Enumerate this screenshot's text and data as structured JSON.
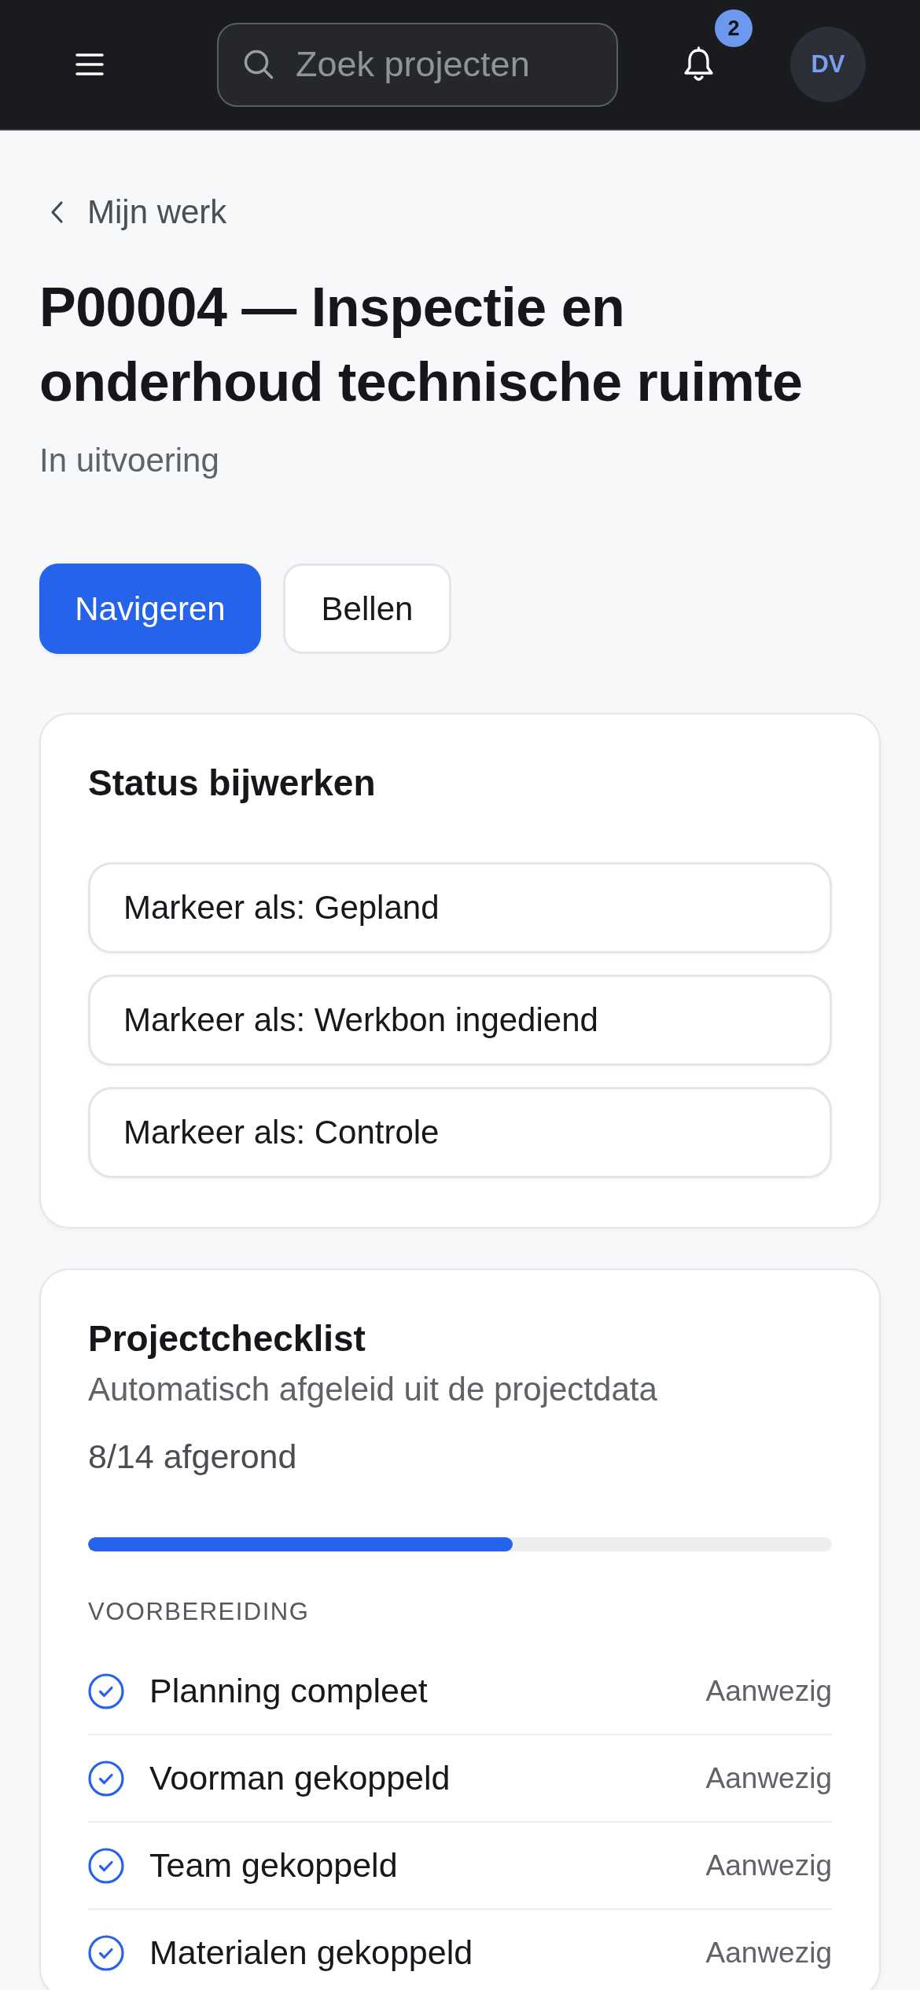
{
  "header": {
    "search": {
      "placeholder": "Zoek projecten"
    },
    "notifications": {
      "badge": "2"
    },
    "avatar": {
      "initials": "DV"
    }
  },
  "back_link": {
    "label": "Mijn werk"
  },
  "project": {
    "title": "P00004 — Inspectie en onderhoud technische ruimte",
    "status": "In uitvoering"
  },
  "actions": [
    {
      "label": "Navigeren",
      "kind": "primary"
    },
    {
      "label": "Bellen",
      "kind": "secondary"
    }
  ],
  "status_card": {
    "title": "Status bijwerken",
    "options": [
      {
        "label": "Markeer als: Gepland"
      },
      {
        "label": "Markeer als: Werkbon ingediend"
      },
      {
        "label": "Markeer als: Controle"
      }
    ]
  },
  "checklist": {
    "title": "Projectchecklist",
    "subtitle": "Automatisch afgeleid uit de projectdata",
    "progress_text": "8/14 afgerond",
    "level": 0.571,
    "sections": [
      {
        "heading": "VOORBEREIDING",
        "items": [
          {
            "label": "Planning compleet",
            "checked": true,
            "status": "Aanwezig"
          },
          {
            "label": "Voorman gekoppeld",
            "checked": true,
            "status": "Aanwezig"
          },
          {
            "label": "Team gekoppeld",
            "checked": true,
            "status": "Aanwezig"
          },
          {
            "label": "Materialen gekoppeld",
            "checked": true,
            "status": "Aanwezig"
          }
        ]
      }
    ]
  }
}
